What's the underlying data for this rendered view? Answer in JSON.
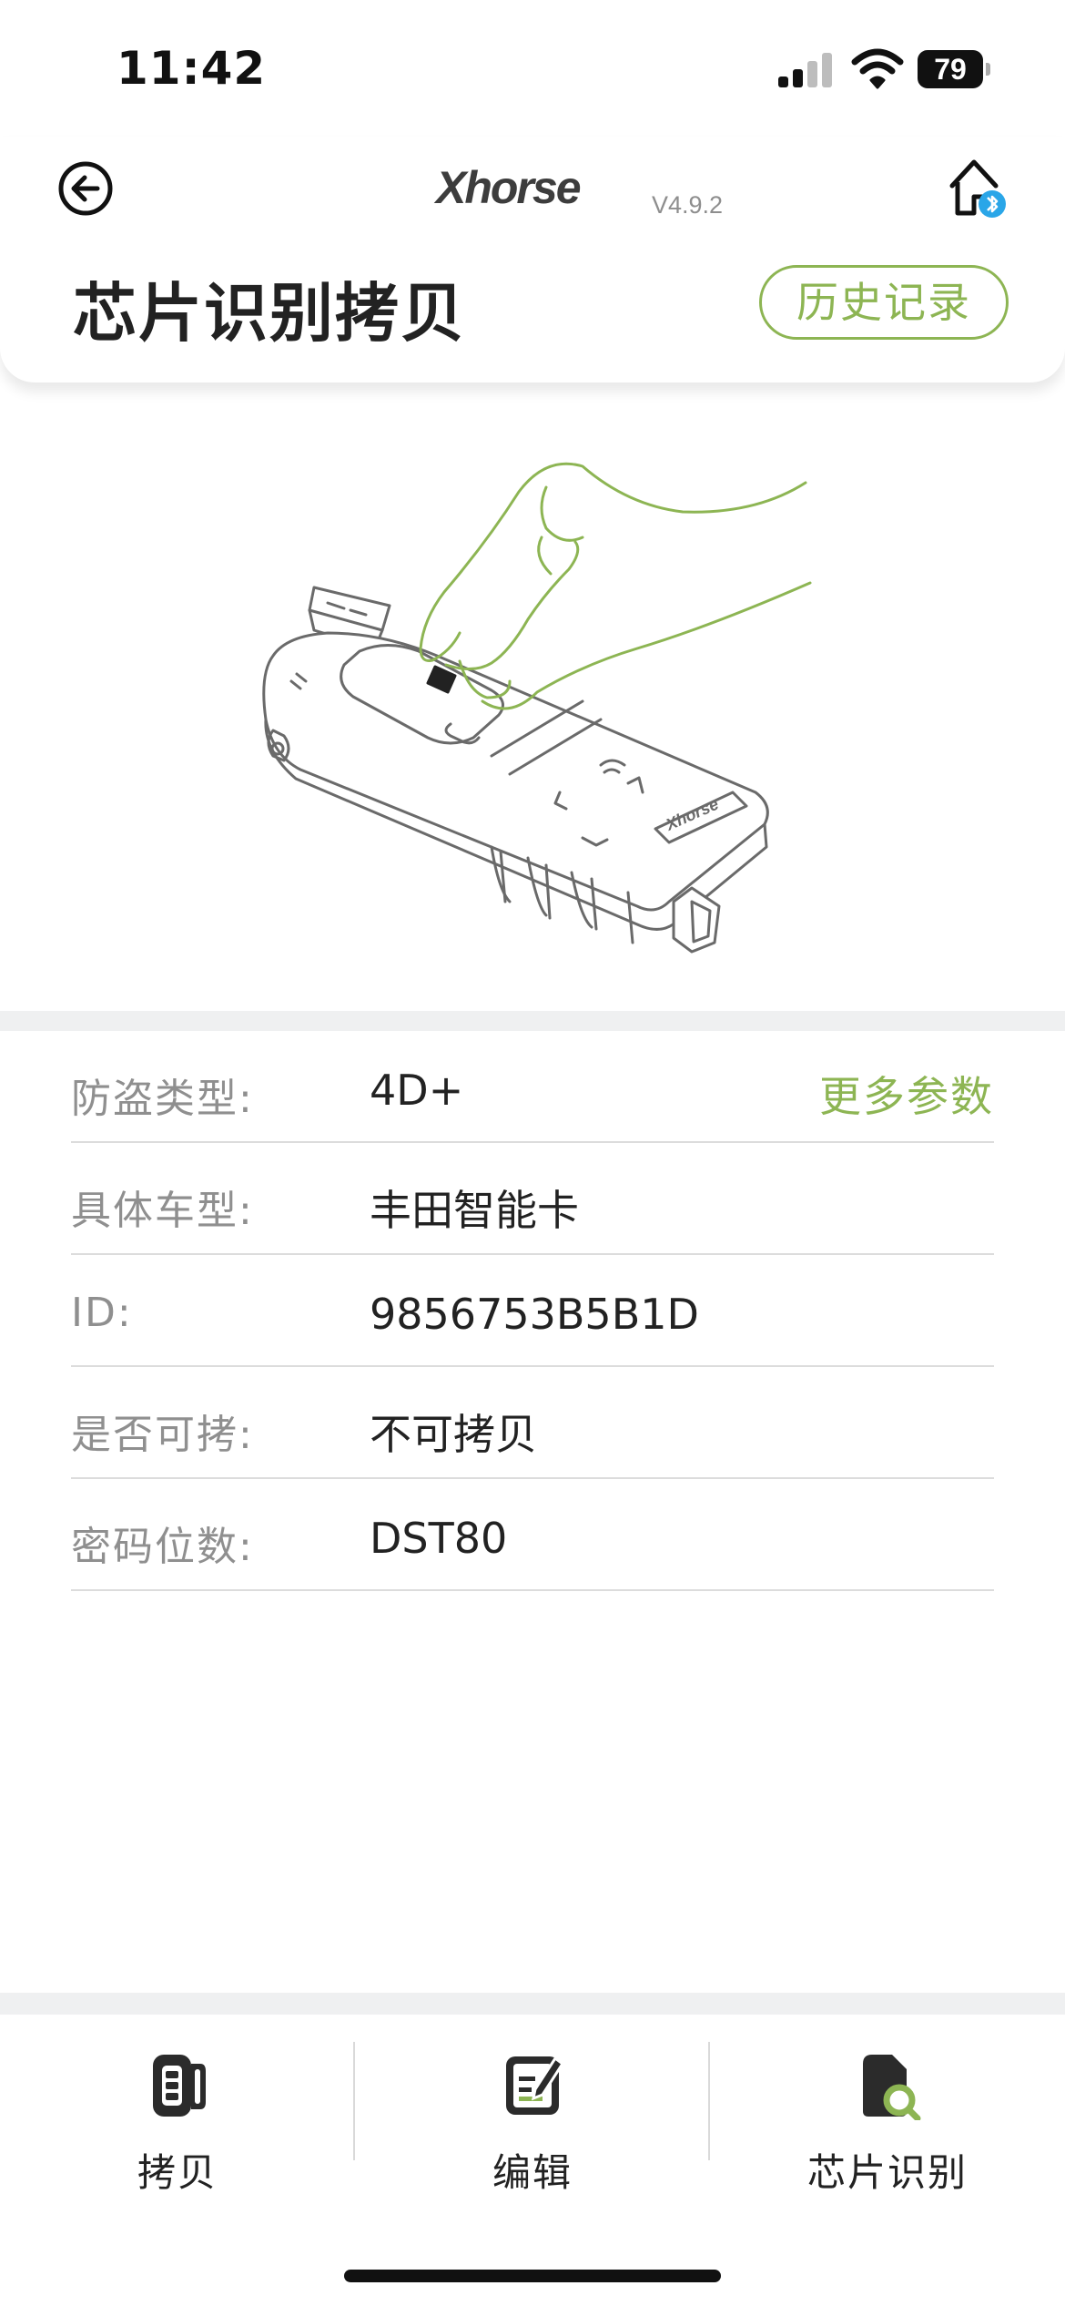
{
  "status_bar": {
    "time": "11:42",
    "battery": "79"
  },
  "header": {
    "brand": "Xhorse",
    "version": "V4.9.2",
    "title": "芯片识别拷贝",
    "history_button": "历史记录"
  },
  "info": {
    "more_params": "更多参数",
    "rows": [
      {
        "label": "防盗类型:",
        "value": "4D+"
      },
      {
        "label": "具体车型:",
        "value": "丰田智能卡"
      },
      {
        "label": "ID:",
        "value": "9856753B5B1D"
      },
      {
        "label": "是否可拷:",
        "value": "不可拷贝"
      },
      {
        "label": "密码位数:",
        "value": "DST80"
      }
    ]
  },
  "bottom_nav": {
    "items": [
      {
        "label": "拷贝",
        "icon": "key-fob-icon"
      },
      {
        "label": "编辑",
        "icon": "edit-document-icon"
      },
      {
        "label": "芯片识别",
        "icon": "chip-search-icon"
      }
    ]
  },
  "colors": {
    "accent": "#8db553",
    "bluetooth": "#2aa6e8",
    "text": "#222222",
    "label": "#8f8f8f"
  },
  "illustration": {
    "device_brand": "Xhorse"
  }
}
